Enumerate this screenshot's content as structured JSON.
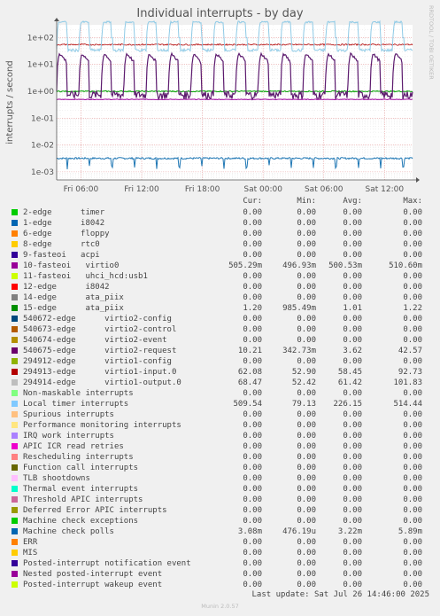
{
  "chart_data": {
    "type": "line",
    "title": "Individual interrupts - by day",
    "ylabel": "interrupts / second",
    "yscale": "log",
    "ylim": [
      0.0005,
      300
    ],
    "y_ticks": [
      "1e+02",
      "1e+01",
      "1e+00",
      "1e-01",
      "1e-02",
      "1e-03"
    ],
    "x_ticks": [
      "Fri 06:00",
      "Fri 12:00",
      "Fri 18:00",
      "Sat 00:00",
      "Sat 06:00",
      "Sat 12:00"
    ],
    "grid": true,
    "series_plotted": [
      {
        "name": "Local timer interrupts",
        "color": "#8ecae6",
        "level": "~30 baseline, periodic peaks ~500",
        "periodic": true
      },
      {
        "name": "294913-edge",
        "color": "#cc0000",
        "level": "~55 steady"
      },
      {
        "name": "540675-edge",
        "color": "#5c1a6e",
        "level": "~0.4 baseline, periodic peaks ~40",
        "periodic": true
      },
      {
        "name": "10-fasteoi",
        "color": "#990099",
        "level": "~0.5 steady"
      },
      {
        "name": "15-edge",
        "color": "#00a000",
        "level": "~1.0 steady"
      },
      {
        "name": "Machine check polls",
        "color": "#1f77b4",
        "level": "~0.003 with downward spikes"
      }
    ]
  },
  "legend": {
    "headers": {
      "cur": "Cur:",
      "min": "Min:",
      "avg": "Avg:",
      "max": "Max:"
    },
    "rows": [
      {
        "name": "2-edge      timer",
        "color": "#00cc00",
        "cur": "0.00",
        "min": "0.00",
        "avg": "0.00",
        "max": "0.00"
      },
      {
        "name": "1-edge      i8042",
        "color": "#0066b3",
        "cur": "0.00",
        "min": "0.00",
        "avg": "0.00",
        "max": "0.00"
      },
      {
        "name": "6-edge      floppy",
        "color": "#ff8000",
        "cur": "0.00",
        "min": "0.00",
        "avg": "0.00",
        "max": "0.00"
      },
      {
        "name": "8-edge      rtc0",
        "color": "#ffcc00",
        "cur": "0.00",
        "min": "0.00",
        "avg": "0.00",
        "max": "0.00"
      },
      {
        "name": "9-fasteoi   acpi",
        "color": "#330099",
        "cur": "0.00",
        "min": "0.00",
        "avg": "0.00",
        "max": "0.00"
      },
      {
        "name": "10-fasteoi   virtio0",
        "color": "#990099",
        "cur": "505.29m",
        "min": "496.93m",
        "avg": "500.53m",
        "max": "510.60m"
      },
      {
        "name": "11-fasteoi   uhci_hcd:usb1",
        "color": "#ccff00",
        "cur": "0.00",
        "min": "0.00",
        "avg": "0.00",
        "max": "0.00"
      },
      {
        "name": "12-edge      i8042",
        "color": "#ff0000",
        "cur": "0.00",
        "min": "0.00",
        "avg": "0.00",
        "max": "0.00"
      },
      {
        "name": "14-edge      ata_piix",
        "color": "#808080",
        "cur": "0.00",
        "min": "0.00",
        "avg": "0.00",
        "max": "0.00"
      },
      {
        "name": "15-edge      ata_piix",
        "color": "#008f00",
        "cur": "1.20",
        "min": "985.49m",
        "avg": "1.01",
        "max": "1.22"
      },
      {
        "name": "540672-edge      virtio2-config",
        "color": "#00487d",
        "cur": "0.00",
        "min": "0.00",
        "avg": "0.00",
        "max": "0.00"
      },
      {
        "name": "540673-edge      virtio2-control",
        "color": "#b35a00",
        "cur": "0.00",
        "min": "0.00",
        "avg": "0.00",
        "max": "0.00"
      },
      {
        "name": "540674-edge      virtio2-event",
        "color": "#b38f00",
        "cur": "0.00",
        "min": "0.00",
        "avg": "0.00",
        "max": "0.00"
      },
      {
        "name": "540675-edge      virtio2-request",
        "color": "#6b006b",
        "cur": "10.21",
        "min": "342.73m",
        "avg": "3.62",
        "max": "42.57"
      },
      {
        "name": "294912-edge      virtio1-config",
        "color": "#8fb300",
        "cur": "0.00",
        "min": "0.00",
        "avg": "0.00",
        "max": "0.00"
      },
      {
        "name": "294913-edge      virtio1-input.0",
        "color": "#b30000",
        "cur": "62.08",
        "min": "52.90",
        "avg": "58.45",
        "max": "92.73"
      },
      {
        "name": "294914-edge      virtio1-output.0",
        "color": "#bebebe",
        "cur": "68.47",
        "min": "52.42",
        "avg": "61.42",
        "max": "101.83"
      },
      {
        "name": "Non-maskable interrupts",
        "color": "#80ff80",
        "cur": "0.00",
        "min": "0.00",
        "avg": "0.00",
        "max": "0.00"
      },
      {
        "name": "Local timer interrupts",
        "color": "#80c9ff",
        "cur": "509.54",
        "min": "79.13",
        "avg": "226.15",
        "max": "514.44"
      },
      {
        "name": "Spurious interrupts",
        "color": "#ffc080",
        "cur": "0.00",
        "min": "0.00",
        "avg": "0.00",
        "max": "0.00"
      },
      {
        "name": "Performance monitoring interrupts",
        "color": "#ffe680",
        "cur": "0.00",
        "min": "0.00",
        "avg": "0.00",
        "max": "0.00"
      },
      {
        "name": "IRQ work interrupts",
        "color": "#aa80ff",
        "cur": "0.00",
        "min": "0.00",
        "avg": "0.00",
        "max": "0.00"
      },
      {
        "name": "APIC ICR read retries",
        "color": "#ee00cc",
        "cur": "0.00",
        "min": "0.00",
        "avg": "0.00",
        "max": "0.00"
      },
      {
        "name": "Rescheduling interrupts",
        "color": "#ff8080",
        "cur": "0.00",
        "min": "0.00",
        "avg": "0.00",
        "max": "0.00"
      },
      {
        "name": "Function call interrupts",
        "color": "#666600",
        "cur": "0.00",
        "min": "0.00",
        "avg": "0.00",
        "max": "0.00"
      },
      {
        "name": "TLB shootdowns",
        "color": "#ffbfff",
        "cur": "0.00",
        "min": "0.00",
        "avg": "0.00",
        "max": "0.00"
      },
      {
        "name": "Thermal event interrupts",
        "color": "#00ffcc",
        "cur": "0.00",
        "min": "0.00",
        "avg": "0.00",
        "max": "0.00"
      },
      {
        "name": "Threshold APIC interrupts",
        "color": "#cc6699",
        "cur": "0.00",
        "min": "0.00",
        "avg": "0.00",
        "max": "0.00"
      },
      {
        "name": "Deferred Error APIC interrupts",
        "color": "#999900",
        "cur": "0.00",
        "min": "0.00",
        "avg": "0.00",
        "max": "0.00"
      },
      {
        "name": "Machine check exceptions",
        "color": "#00cc00",
        "cur": "0.00",
        "min": "0.00",
        "avg": "0.00",
        "max": "0.00"
      },
      {
        "name": "Machine check polls",
        "color": "#0066b3",
        "cur": "3.08m",
        "min": "476.19u",
        "avg": "3.22m",
        "max": "5.89m"
      },
      {
        "name": "ERR",
        "color": "#ff8000",
        "cur": "0.00",
        "min": "0.00",
        "avg": "0.00",
        "max": "0.00"
      },
      {
        "name": "MIS",
        "color": "#ffcc00",
        "cur": "0.00",
        "min": "0.00",
        "avg": "0.00",
        "max": "0.00"
      },
      {
        "name": "Posted-interrupt notification event",
        "color": "#330099",
        "cur": "0.00",
        "min": "0.00",
        "avg": "0.00",
        "max": "0.00"
      },
      {
        "name": "Nested posted-interrupt event",
        "color": "#990099",
        "cur": "0.00",
        "min": "0.00",
        "avg": "0.00",
        "max": "0.00"
      },
      {
        "name": "Posted-interrupt wakeup event",
        "color": "#ccff00",
        "cur": "0.00",
        "min": "0.00",
        "avg": "0.00",
        "max": "0.00"
      }
    ]
  },
  "side_credit": "RRDTOOL / TOBI OETIKER",
  "last_update": "Last update: Sat Jul 26 14:46:00 2025",
  "footer": "Munin 2.0.57"
}
